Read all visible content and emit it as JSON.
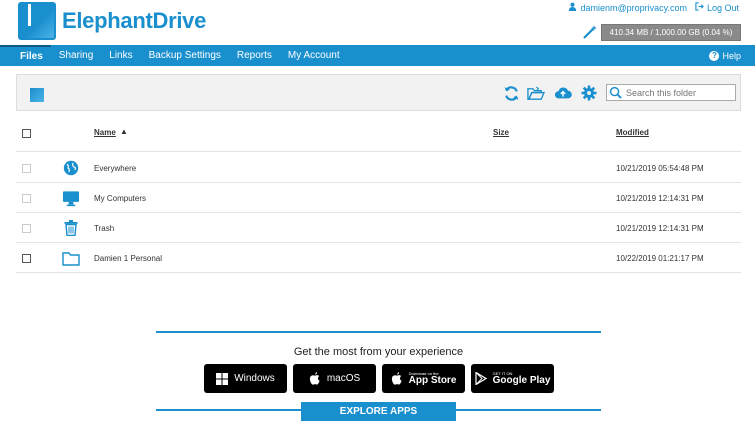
{
  "brand": {
    "name": "ElephantDrive"
  },
  "account": {
    "email": "damienm@proprivacy.com",
    "logout": "Log Out",
    "usage": "410.34 MB / 1,000.00 GB (0.04 %)",
    "usage_fraction": 0.0004
  },
  "nav": {
    "items": [
      "Files",
      "Sharing",
      "Links",
      "Backup Settings",
      "Reports",
      "My Account"
    ],
    "active": "Files",
    "help": "Help"
  },
  "toolbar": {
    "search_placeholder": "Search this folder",
    "icons": [
      "refresh-icon",
      "open-folder-icon",
      "cloud-upload-icon",
      "gear-icon",
      "search-icon"
    ]
  },
  "table": {
    "columns": {
      "name": "Name",
      "size": "Size",
      "modified": "Modified"
    },
    "sort": {
      "column": "Name",
      "direction": "ascending"
    },
    "rows": [
      {
        "name": "Everywhere",
        "size": "",
        "modified": "10/21/2019 05:54:48 PM",
        "icon": "globe-icon"
      },
      {
        "name": "My Computers",
        "size": "",
        "modified": "10/21/2019 12:14:31 PM",
        "icon": "monitor-icon"
      },
      {
        "name": "Trash",
        "size": "",
        "modified": "10/21/2019 12:14:31 PM",
        "icon": "trash-icon"
      },
      {
        "name": "Damien 1 Personal",
        "size": "",
        "modified": "10/22/2019 01:21:17 PM",
        "icon": "folder-icon"
      }
    ]
  },
  "promo": {
    "text": "Get the most from your experience",
    "apps": [
      {
        "label": "Windows",
        "icon": "windows-icon"
      },
      {
        "label": "macOS",
        "icon": "apple-icon"
      },
      {
        "small": "Download on the",
        "big": "App Store",
        "icon": "apple-icon"
      },
      {
        "small": "GET IT ON",
        "big": "Google Play",
        "icon": "google-play-icon"
      }
    ],
    "explore": "EXPLORE APPS"
  },
  "colors": {
    "brand_blue": "#1a8fce",
    "usage_bar": "#8a8a8a"
  }
}
